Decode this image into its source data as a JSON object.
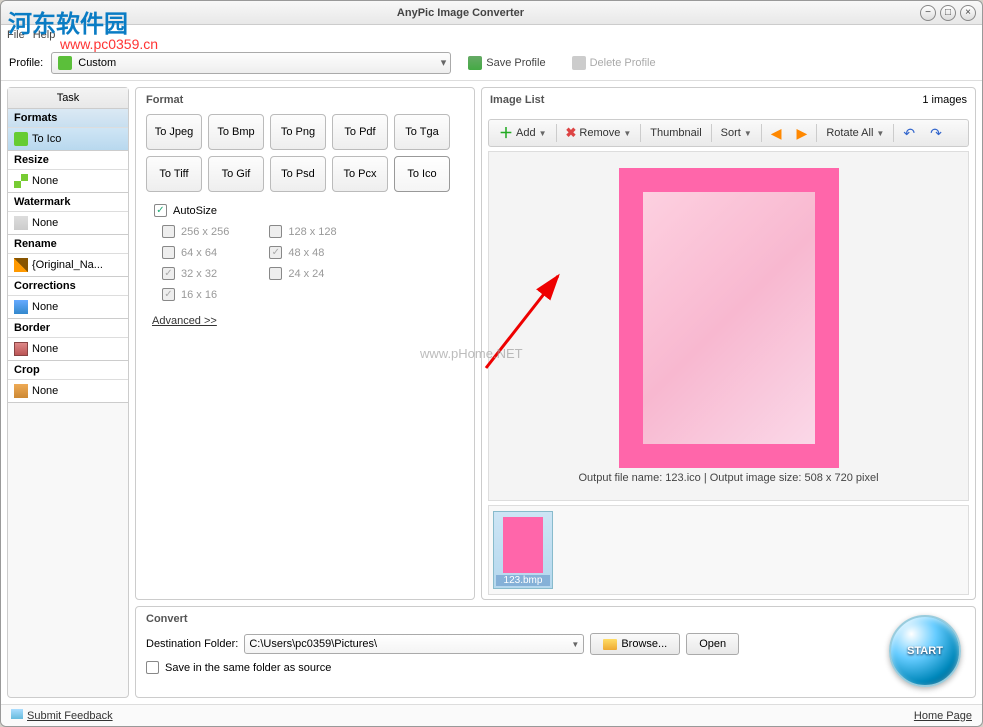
{
  "window": {
    "title": "AnyPic Image Converter"
  },
  "menu": {
    "file": "File",
    "help": "Help"
  },
  "profile": {
    "label": "Profile:",
    "value": "Custom",
    "save": "Save Profile",
    "delete": "Delete Profile"
  },
  "task": {
    "header": "Task",
    "sections": [
      {
        "title": "Formats",
        "sub": "To Ico",
        "active": true,
        "icon": "ico-toico"
      },
      {
        "title": "Resize",
        "sub": "None",
        "icon": "ico-resize"
      },
      {
        "title": "Watermark",
        "sub": "None",
        "icon": "ico-wm"
      },
      {
        "title": "Rename",
        "sub": "{Original_Na...",
        "icon": "ico-rename"
      },
      {
        "title": "Corrections",
        "sub": "None",
        "icon": "ico-corr"
      },
      {
        "title": "Border",
        "sub": "None",
        "icon": "ico-border"
      },
      {
        "title": "Crop",
        "sub": "None",
        "icon": "ico-crop"
      }
    ]
  },
  "format": {
    "title": "Format",
    "buttons": [
      "To Jpeg",
      "To Bmp",
      "To Png",
      "To Pdf",
      "To Tga",
      "To Tiff",
      "To Gif",
      "To Psd",
      "To Pcx",
      "To Ico"
    ],
    "activeIndex": 9,
    "autosize": "AutoSize",
    "sizesL": [
      {
        "label": "256 x 256",
        "checked": false,
        "disabled": true
      },
      {
        "label": "64 x 64",
        "checked": false,
        "disabled": true
      },
      {
        "label": "32 x 32",
        "checked": true,
        "disabled": true
      },
      {
        "label": "16 x 16",
        "checked": true,
        "disabled": true
      }
    ],
    "sizesR": [
      {
        "label": "128 x 128",
        "checked": false,
        "disabled": true
      },
      {
        "label": "48 x 48",
        "checked": true,
        "disabled": true
      },
      {
        "label": "24 x 24",
        "checked": false,
        "disabled": true
      }
    ],
    "advanced": "Advanced >>"
  },
  "imagelist": {
    "title": "Image List",
    "count": "1 images",
    "add": "Add",
    "remove": "Remove",
    "thumbnail": "Thumbnail",
    "sort": "Sort",
    "rotate": "Rotate All",
    "caption": "Output file name: 123.ico | Output image size: 508 x 720 pixel",
    "thumb": "123.bmp"
  },
  "convert": {
    "title": "Convert",
    "destLabel": "Destination Folder:",
    "path": "C:\\Users\\pc0359\\Pictures\\",
    "browse": "Browse...",
    "open": "Open",
    "sameFolder": "Save in the same folder as source",
    "start": "START"
  },
  "footer": {
    "feedback": "Submit Feedback",
    "home": "Home Page"
  },
  "watermark": {
    "logo": "河东软件园",
    "url": "www.pc0359.cn",
    "center": "www.pHome.NET"
  }
}
